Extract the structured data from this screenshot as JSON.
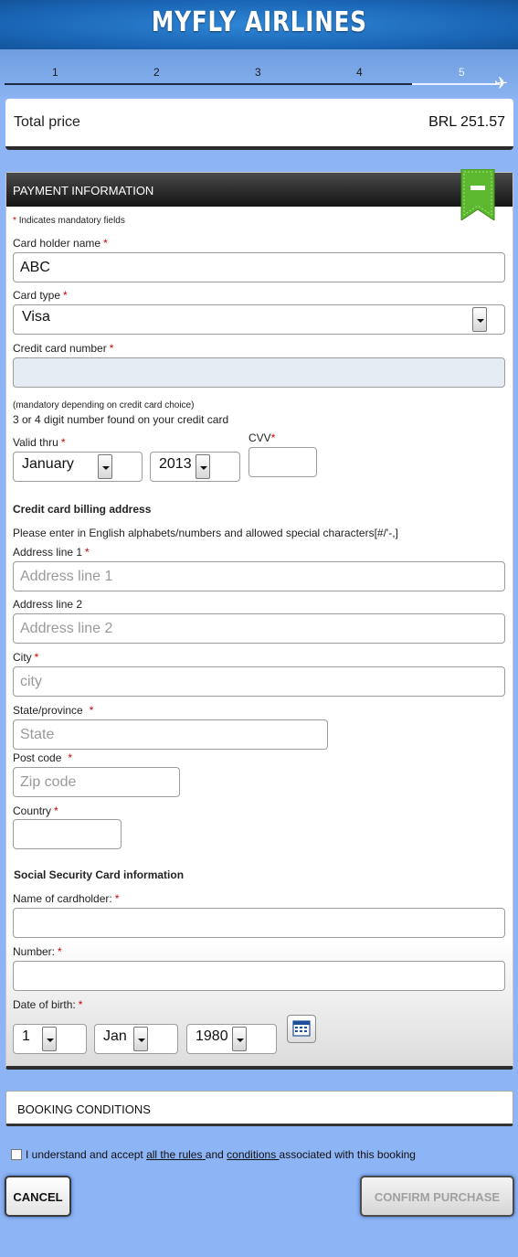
{
  "header": {
    "title": "MYFLY AIRLINES"
  },
  "steps": [
    "1",
    "2",
    "3",
    "4",
    "5"
  ],
  "summary": {
    "total_label": "Total price",
    "total_value": "BRL 251.57"
  },
  "payment": {
    "title": "PAYMENT INFORMATION",
    "mandatory_note": "Indicates mandatory fields",
    "card_holder_label": "Card holder name",
    "card_holder_value": "ABC",
    "card_type_label": "Card type",
    "card_type_value": "Visa",
    "card_number_label": "Credit card number",
    "card_number_value": "",
    "cvv_note_small": "(mandatory depending on credit card choice)",
    "cvv_note": "3 or 4 digit number found on your credit card",
    "valid_thru_label": "Valid thru",
    "valid_month": "January",
    "valid_year": "2013",
    "cvv_label": "CVV",
    "cvv_value": ""
  },
  "billing": {
    "title": "Credit card billing address",
    "instructions": "Please enter in English alphabets/numbers and allowed special characters[#/'-,]",
    "address1_label": "Address line 1",
    "address1_placeholder": "Address line 1",
    "address2_label": "Address line 2",
    "address2_placeholder": "Address line 2",
    "city_label": "City",
    "city_placeholder": "city",
    "state_label": "State/province",
    "state_placeholder": "State",
    "postcode_label": "Post code",
    "postcode_placeholder": "Zip code",
    "country_label": "Country",
    "country_value": ""
  },
  "ssc": {
    "title": "Social Security Card information",
    "name_label": "Name of cardholder:",
    "number_label": "Number:",
    "dob_label": "Date of birth:",
    "dob_day": "1",
    "dob_month": "Jan",
    "dob_year": "1980"
  },
  "booking_conditions": {
    "label": "BOOKING CONDITIONS"
  },
  "accept": {
    "text_before": "I understand and accept ",
    "link1": "all the rules ",
    "text_mid": "and ",
    "link2": "conditions ",
    "text_after": "associated with this booking"
  },
  "buttons": {
    "cancel": "CANCEL",
    "confirm": "CONFIRM PURCHASE"
  },
  "colors": {
    "header_blue": "#1a64b4",
    "page_bg": "#8db4f4",
    "required": "#cc0000",
    "ribbon_green": "#5cb82e"
  },
  "icons": {
    "ribbon": "collapse-ribbon-icon",
    "plane": "airplane-icon",
    "calendar": "calendar-icon"
  }
}
